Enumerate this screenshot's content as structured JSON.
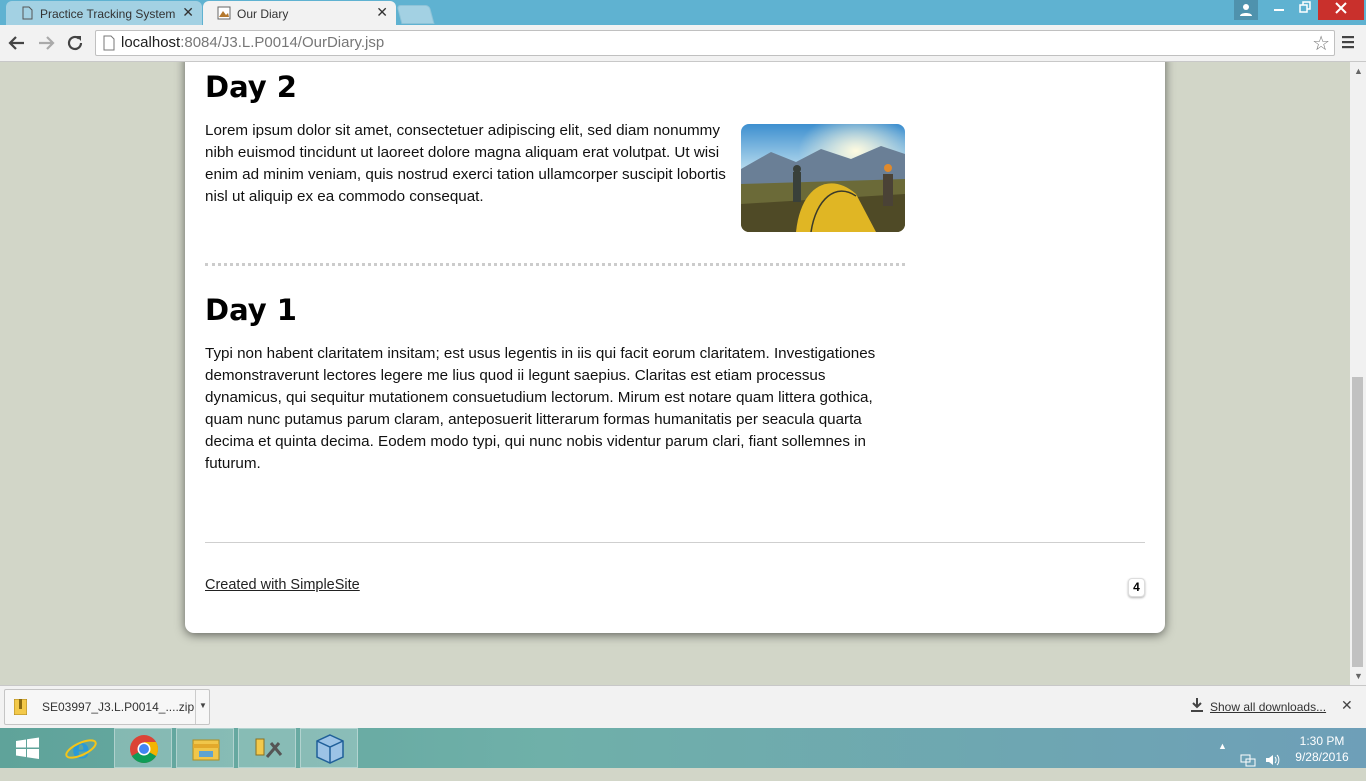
{
  "browser": {
    "tabs": [
      {
        "label": "Practice Tracking System",
        "active": false
      },
      {
        "label": "Our Diary",
        "active": true
      }
    ],
    "url_host": "localhost",
    "url_rest": ":8084/J3.L.P0014/OurDiary.jsp"
  },
  "page": {
    "posts": [
      {
        "title": "Day 2",
        "body": "Lorem ipsum dolor sit amet, consectetuer adipiscing elit, sed diam nonummy nibh euismod tincidunt ut laoreet dolore magna aliquam erat volutpat. Ut wisi enim ad minim veniam, quis nostrud exerci tation ullamcorper suscipit lobortis nisl ut aliquip ex ea commodo consequat."
      },
      {
        "title": "Day 1",
        "body": "Typi non habent claritatem insitam; est usus legentis in iis qui facit eorum claritatem. Investigationes demonstraverunt lectores legere me lius quod ii legunt saepius. Claritas est etiam processus dynamicus, qui sequitur mutationem consuetudium lectorum. Mirum est notare quam littera gothica, quam nunc putamus parum claram, anteposuerit litterarum formas humanitatis per seacula quarta decima et quinta decima. Eodem modo typi, qui nunc nobis videntur parum clari, fiant sollemnes in futurum."
      }
    ],
    "footer_link": "Created with SimpleSite",
    "page_badge": "4"
  },
  "downloads": {
    "file_name": "SE03997_J3.L.P0014_....zip",
    "show_all": "Show all downloads..."
  },
  "taskbar": {
    "time": "1:30 PM",
    "date": "9/28/2016",
    "apps": [
      "windows-start-icon",
      "internet-explorer-icon",
      "chrome-icon",
      "file-explorer-icon",
      "tools-icon",
      "virtualbox-icon"
    ]
  },
  "colors": {
    "tab_strip": "#5fb2d1",
    "page_background": "#d2d6c8",
    "close_button": "#c9302c"
  }
}
